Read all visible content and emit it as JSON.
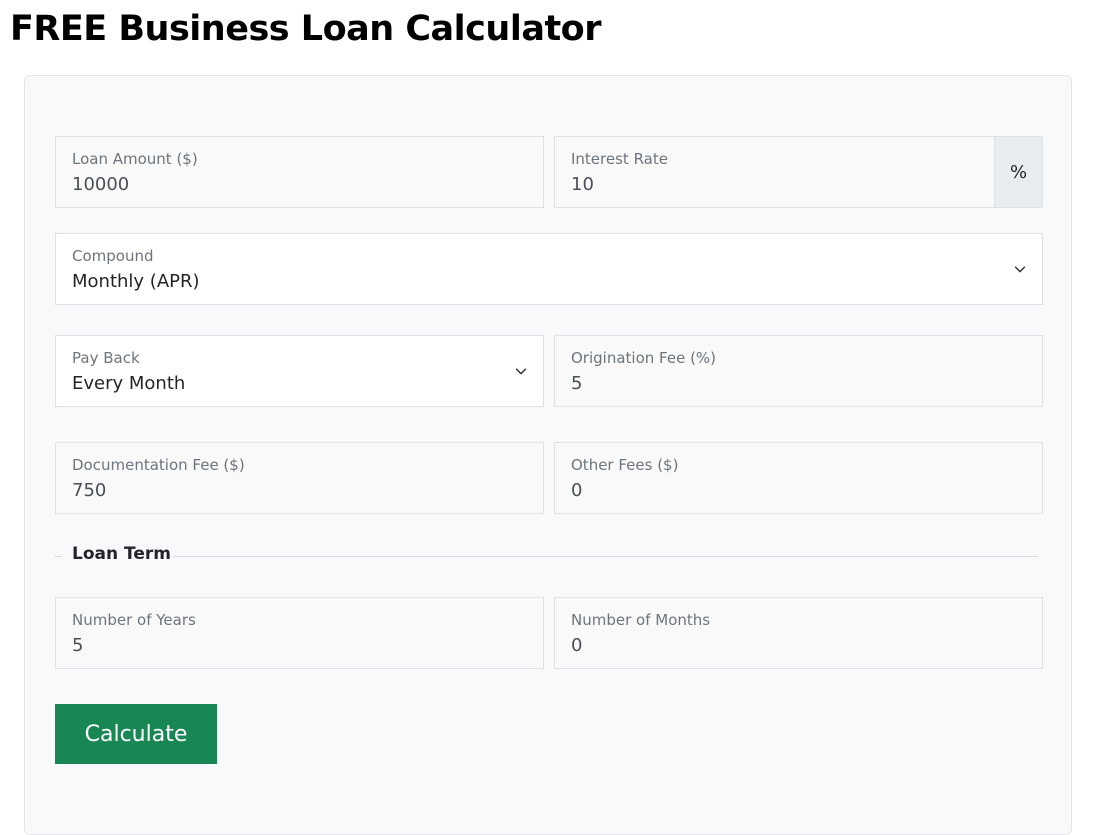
{
  "page": {
    "title": "FREE Business Loan Calculator"
  },
  "form": {
    "loan_amount": {
      "label": "Loan Amount ($)",
      "value": "10000"
    },
    "interest_rate": {
      "label": "Interest Rate",
      "value": "10",
      "addon": "%"
    },
    "compound": {
      "label": "Compound",
      "selected": "Monthly (APR)"
    },
    "pay_back": {
      "label": "Pay Back",
      "selected": "Every Month"
    },
    "origination_fee": {
      "label": "Origination Fee (%)",
      "value": "5"
    },
    "documentation_fee": {
      "label": "Documentation Fee ($)",
      "value": "750"
    },
    "other_fees": {
      "label": "Other Fees ($)",
      "value": "0"
    },
    "loan_term": {
      "title": "Loan Term",
      "years": {
        "label": "Number of Years",
        "value": "5"
      },
      "months": {
        "label": "Number of Months",
        "value": "0"
      }
    },
    "calculate_label": "Calculate"
  },
  "colors": {
    "primary_button": "#198754",
    "card_background": "#f8f9fa",
    "addon_background": "#e9ecef"
  }
}
